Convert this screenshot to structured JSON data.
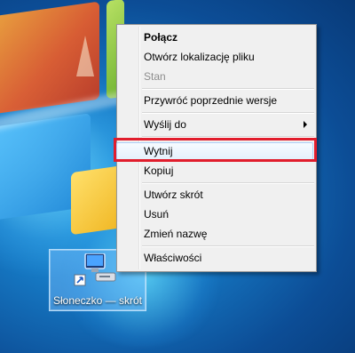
{
  "desktop": {
    "shortcut_label": "Słoneczko — skrót",
    "shortcut_icon": "network-computer-icon"
  },
  "context_menu": {
    "items": [
      {
        "label": "Połącz",
        "style": "bold"
      },
      {
        "label": "Otwórz lokalizację pliku"
      },
      {
        "label": "Stan",
        "state": "disabled"
      },
      {
        "label": "Przywróć poprzednie wersje"
      },
      {
        "label": "Wyślij do",
        "has_submenu": true
      },
      {
        "label": "Wytnij",
        "highlighted": true
      },
      {
        "label": "Kopiuj"
      },
      {
        "label": "Utwórz skrót"
      },
      {
        "label": "Usuń"
      },
      {
        "label": "Zmień nazwę"
      },
      {
        "label": "Właściwości"
      }
    ]
  },
  "colors": {
    "highlight_border": "#e11d2c",
    "menu_bg": "#f0f0f0"
  }
}
